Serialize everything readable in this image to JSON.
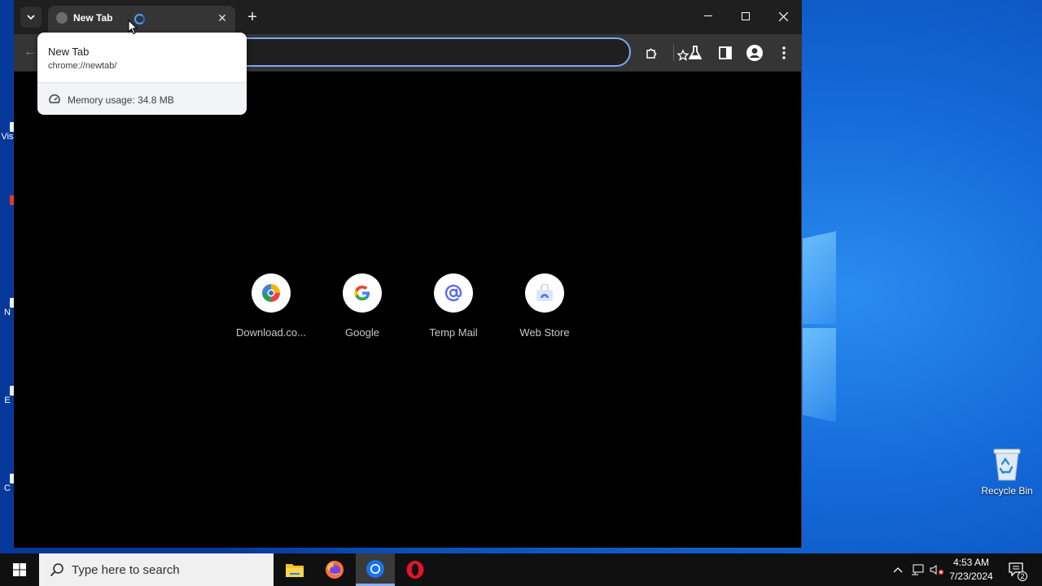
{
  "browser": {
    "tab": {
      "title": "New Tab"
    },
    "hover_card": {
      "title": "New Tab",
      "url": "chrome://newtab/",
      "memory": "Memory usage: 34.8 MB"
    },
    "shortcuts": [
      {
        "label": "Download.co...",
        "icon": "downloadcom-icon"
      },
      {
        "label": "Google",
        "icon": "google-icon"
      },
      {
        "label": "Temp Mail",
        "icon": "at-sign-icon"
      },
      {
        "label": "Web Store",
        "icon": "web-store-icon"
      }
    ],
    "colors": {
      "frame": "#1f1f1f",
      "toolbar": "#353535",
      "focus_ring": "#7aa7ff",
      "page": "#000000"
    }
  },
  "desktop": {
    "recycle_bin_label": "Recycle Bin",
    "left_edge_label_fragments": [
      "Vis",
      "N",
      "E",
      "C"
    ]
  },
  "taskbar": {
    "search_placeholder": "Type here to search",
    "time": "4:53 AM",
    "date": "7/23/2024",
    "notification_count": "2",
    "apps": [
      "file-explorer-icon",
      "firefox-icon",
      "chrome-icon",
      "opera-icon"
    ]
  }
}
